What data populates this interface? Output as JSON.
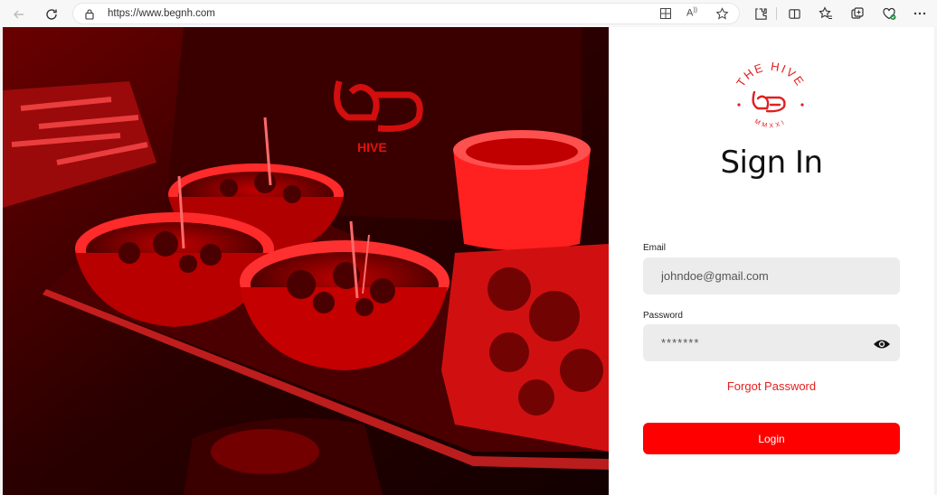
{
  "browser": {
    "url": "https://www.begnh.com",
    "icons": [
      "back-icon",
      "refresh-icon",
      "lock-icon",
      "app-grid-icon",
      "read-aloud-icon",
      "favorite-star-icon",
      "extensions-icon",
      "split-screen-icon",
      "favorites-icon",
      "collections-icon",
      "browser-essentials-icon",
      "more-icon"
    ]
  },
  "hero": {
    "image": "red-tinted photo of food bowls on a tray"
  },
  "signin": {
    "logo_top_text": "THE HIVE",
    "logo_bottom_text": "M M X X I",
    "title": "Sign In",
    "email_label": "Email",
    "email_value": "johndoe@gmail.com",
    "password_label": "Password",
    "password_value": "*******",
    "forgot_label": "Forgot Password",
    "login_label": "Login"
  },
  "colors": {
    "accent": "#ff0000",
    "link": "#e32020",
    "field_bg": "#ececec"
  }
}
